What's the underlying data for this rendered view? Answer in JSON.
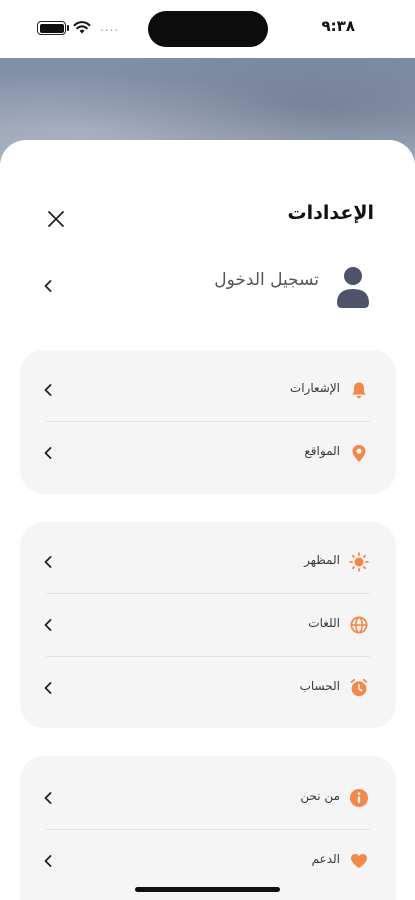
{
  "status_bar": {
    "time": "٩:٣٨",
    "carrier": "....",
    "battery_level": 1.0
  },
  "sheet": {
    "title": "الإعدادات",
    "close_icon": "close-icon"
  },
  "login": {
    "label": "تسجيل الدخول",
    "icon": "user-icon"
  },
  "groups": [
    {
      "items": [
        {
          "label": "الإشعارات",
          "icon": "bell-icon"
        },
        {
          "label": "المواقع",
          "icon": "location-pin-icon"
        }
      ]
    },
    {
      "items": [
        {
          "label": "المظهر",
          "icon": "sun-icon"
        },
        {
          "label": "اللغات",
          "icon": "globe-icon"
        },
        {
          "label": "الحساب",
          "icon": "account-clock-icon"
        }
      ]
    },
    {
      "items": [
        {
          "label": "من نحن",
          "icon": "info-icon"
        },
        {
          "label": "الدعم",
          "icon": "heart-icon"
        }
      ]
    }
  ],
  "colors": {
    "accent": "#F2894B",
    "card_bg": "#F5F5F5",
    "avatar": "#4E5369",
    "text": "#3A3A3A"
  }
}
